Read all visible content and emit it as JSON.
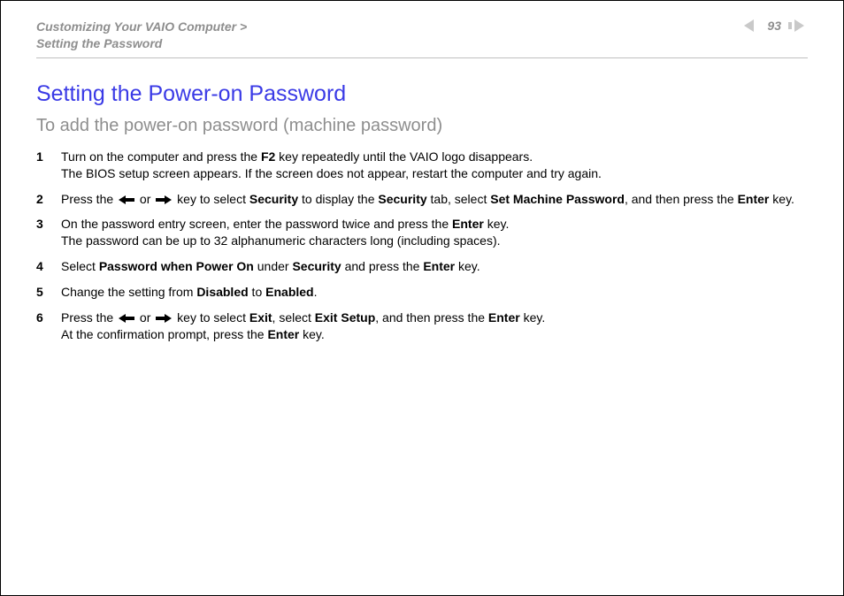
{
  "header": {
    "breadcrumb": {
      "section": "Customizing Your VAIO Computer",
      "separator": " >",
      "topic": "Setting the Password"
    },
    "page_number": "93"
  },
  "content": {
    "title": "Setting the Power-on Password",
    "subtitle": "To add the power-on password (machine password)",
    "steps": [
      {
        "num": "1",
        "lines": [
          [
            {
              "t": "text",
              "v": "Turn on the computer and press the "
            },
            {
              "t": "bold",
              "v": "F2"
            },
            {
              "t": "text",
              "v": " key repeatedly until the VAIO logo disappears."
            }
          ],
          [
            {
              "t": "text",
              "v": "The BIOS setup screen appears. If the screen does not appear, restart the computer and try again."
            }
          ]
        ]
      },
      {
        "num": "2",
        "lines": [
          [
            {
              "t": "text",
              "v": "Press the "
            },
            {
              "t": "arrow",
              "dir": "left"
            },
            {
              "t": "text",
              "v": " or "
            },
            {
              "t": "arrow",
              "dir": "right"
            },
            {
              "t": "text",
              "v": " key to select "
            },
            {
              "t": "bold",
              "v": "Security"
            },
            {
              "t": "text",
              "v": " to display the "
            },
            {
              "t": "bold",
              "v": "Security"
            },
            {
              "t": "text",
              "v": " tab, select "
            },
            {
              "t": "bold",
              "v": "Set Machine Password"
            },
            {
              "t": "text",
              "v": ", and then press the "
            },
            {
              "t": "bold",
              "v": "Enter"
            },
            {
              "t": "text",
              "v": " key."
            }
          ]
        ]
      },
      {
        "num": "3",
        "lines": [
          [
            {
              "t": "text",
              "v": "On the password entry screen, enter the password twice and press the "
            },
            {
              "t": "bold",
              "v": "Enter"
            },
            {
              "t": "text",
              "v": " key."
            }
          ],
          [
            {
              "t": "text",
              "v": "The password can be up to 32 alphanumeric characters long (including spaces)."
            }
          ]
        ]
      },
      {
        "num": "4",
        "lines": [
          [
            {
              "t": "text",
              "v": "Select "
            },
            {
              "t": "bold",
              "v": "Password when Power On"
            },
            {
              "t": "text",
              "v": " under "
            },
            {
              "t": "bold",
              "v": "Security"
            },
            {
              "t": "text",
              "v": " and press the "
            },
            {
              "t": "bold",
              "v": "Enter"
            },
            {
              "t": "text",
              "v": " key."
            }
          ]
        ]
      },
      {
        "num": "5",
        "lines": [
          [
            {
              "t": "text",
              "v": "Change the setting from "
            },
            {
              "t": "bold",
              "v": "Disabled"
            },
            {
              "t": "text",
              "v": " to "
            },
            {
              "t": "bold",
              "v": "Enabled"
            },
            {
              "t": "text",
              "v": "."
            }
          ]
        ]
      },
      {
        "num": "6",
        "lines": [
          [
            {
              "t": "text",
              "v": "Press the "
            },
            {
              "t": "arrow",
              "dir": "left"
            },
            {
              "t": "text",
              "v": " or "
            },
            {
              "t": "arrow",
              "dir": "right"
            },
            {
              "t": "text",
              "v": " key to select "
            },
            {
              "t": "bold",
              "v": "Exit"
            },
            {
              "t": "text",
              "v": ", select "
            },
            {
              "t": "bold",
              "v": "Exit Setup"
            },
            {
              "t": "text",
              "v": ", and then press the "
            },
            {
              "t": "bold",
              "v": "Enter"
            },
            {
              "t": "text",
              "v": " key."
            }
          ],
          [
            {
              "t": "text",
              "v": "At the confirmation prompt, press the "
            },
            {
              "t": "bold",
              "v": "Enter"
            },
            {
              "t": "text",
              "v": " key."
            }
          ]
        ]
      }
    ]
  }
}
